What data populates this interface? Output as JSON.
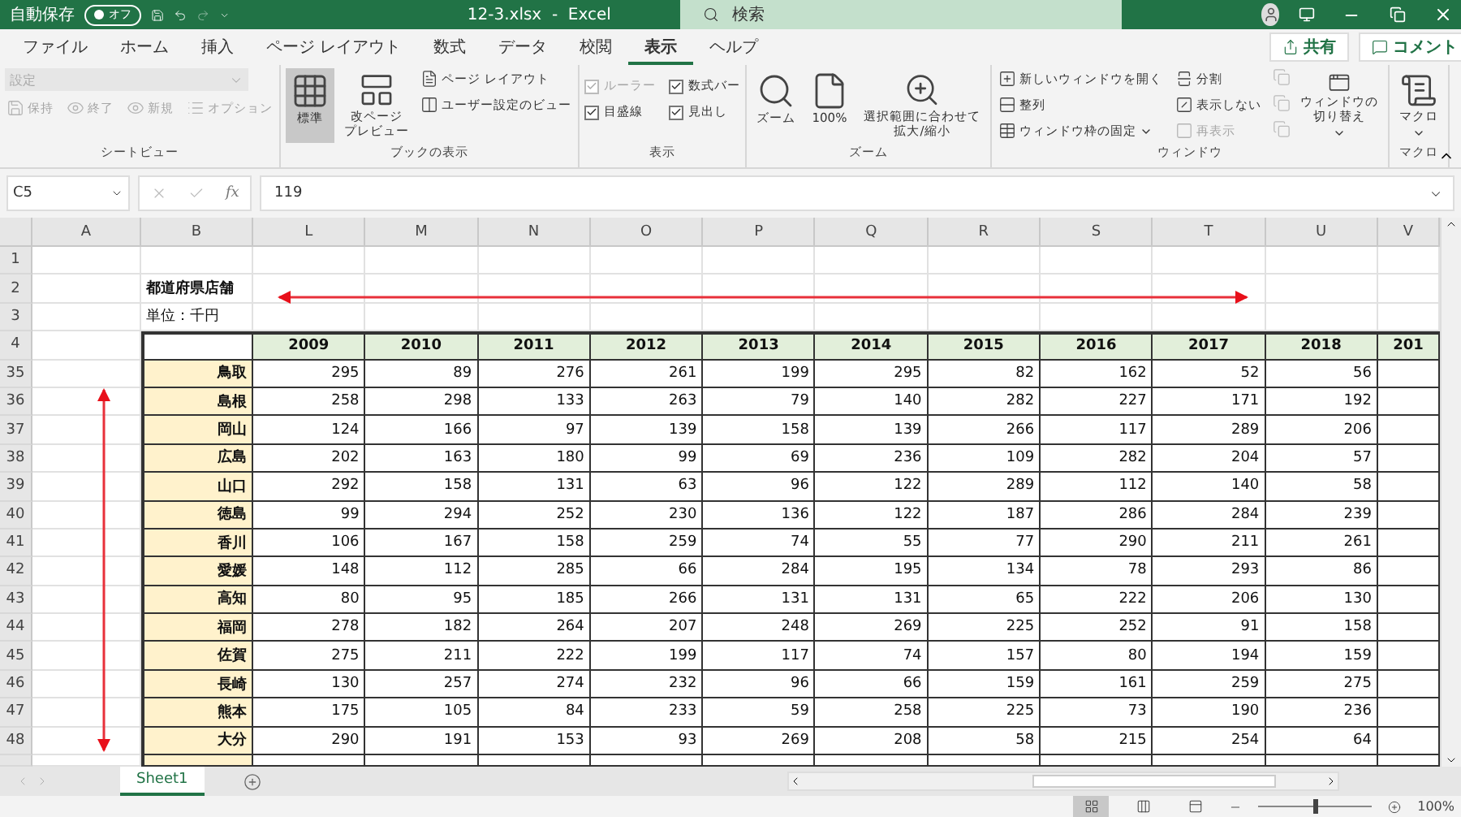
{
  "title_bar": {
    "autosave_label": "自動保存",
    "autosave_state": "オフ",
    "autosave_on": false,
    "file_title": "12-3.xlsx  -  Excel",
    "search_placeholder": "検索"
  },
  "menu_tabs": [
    {
      "label": "ファイル",
      "selected": false
    },
    {
      "label": "ホーム",
      "selected": false
    },
    {
      "label": "挿入",
      "selected": false
    },
    {
      "label": "ページ レイアウト",
      "selected": false
    },
    {
      "label": "数式",
      "selected": false
    },
    {
      "label": "データ",
      "selected": false
    },
    {
      "label": "校閲",
      "selected": false
    },
    {
      "label": "表示",
      "selected": true
    },
    {
      "label": "ヘルプ",
      "selected": false
    }
  ],
  "share_button": "共有",
  "comment_button": "コメント",
  "ribbon_groups": [
    {
      "label": "シートビュー",
      "items": [
        {
          "kind": "dropdown",
          "label": "設定",
          "disabled": true
        },
        {
          "kind": "small",
          "label": "保持",
          "disabled": true
        },
        {
          "kind": "small",
          "label": "終了",
          "disabled": true
        },
        {
          "kind": "small",
          "label": "新規",
          "disabled": true
        },
        {
          "kind": "small",
          "label": "オプション",
          "disabled": true
        }
      ]
    },
    {
      "label": "ブックの表示",
      "items": [
        {
          "kind": "large",
          "label": "標準",
          "selected": true
        },
        {
          "kind": "large",
          "lines": [
            "改ページ",
            "プレビュー"
          ],
          "selected": false
        },
        {
          "kind": "small",
          "label": "ページ レイアウト",
          "disabled": false
        },
        {
          "kind": "small",
          "label": "ユーザー設定のビュー",
          "disabled": false
        }
      ]
    },
    {
      "label": "表示",
      "items": [
        {
          "kind": "check",
          "label": "ルーラー",
          "checked": true,
          "disabled": true
        },
        {
          "kind": "check",
          "label": "目盛線",
          "checked": true,
          "disabled": false
        },
        {
          "kind": "check",
          "label": "数式バー",
          "checked": true,
          "disabled": false
        },
        {
          "kind": "check",
          "label": "見出し",
          "checked": true,
          "disabled": false
        }
      ]
    },
    {
      "label": "ズーム",
      "items": [
        {
          "kind": "large",
          "label": "ズーム",
          "selected": false
        },
        {
          "kind": "large",
          "label": "100%",
          "selected": false
        },
        {
          "kind": "large",
          "lines": [
            "選択範囲に合わせて",
            "拡大/縮小"
          ],
          "selected": false
        }
      ]
    },
    {
      "label": "ウィンドウ",
      "items": [
        {
          "kind": "small",
          "label": "新しいウィンドウを開く",
          "disabled": false
        },
        {
          "kind": "small",
          "label": "整列",
          "disabled": false
        },
        {
          "kind": "small",
          "label": "ウィンドウ枠の固定",
          "disabled": false,
          "dropdown": true
        },
        {
          "kind": "small",
          "label": "分割",
          "disabled": false
        },
        {
          "kind": "small",
          "label": "表示しない",
          "disabled": false
        },
        {
          "kind": "small",
          "label": "再表示",
          "disabled": true
        },
        {
          "kind": "icon",
          "disabled": true
        },
        {
          "kind": "icon",
          "disabled": true
        },
        {
          "kind": "icon",
          "disabled": true
        },
        {
          "kind": "large",
          "lines": [
            "ウィンドウの",
            "切り替え"
          ],
          "selected": false,
          "dropdown": true
        }
      ]
    },
    {
      "label": "マクロ",
      "items": [
        {
          "kind": "large",
          "label": "マクロ",
          "selected": false,
          "dropdown": true
        }
      ]
    }
  ],
  "formula_bar": {
    "name_box": "C5",
    "function_label": "fx",
    "formula": "119"
  },
  "sheet": {
    "columns": [
      "A",
      "B",
      "L",
      "M",
      "N",
      "O",
      "P",
      "Q",
      "R",
      "S",
      "T",
      "U",
      "V"
    ],
    "rows": [
      {
        "number": "1",
        "kind": "blank"
      },
      {
        "number": "2",
        "kind": "title",
        "text": "都道府県店舗"
      },
      {
        "number": "3",
        "kind": "unit",
        "text": "単位：千円"
      },
      {
        "number": "4",
        "kind": "header",
        "values": [
          "2009",
          "2010",
          "2011",
          "2012",
          "2013",
          "2014",
          "2015",
          "2016",
          "2017",
          "2018",
          "201"
        ]
      },
      {
        "number": "35",
        "kind": "data",
        "prefecture": "鳥取",
        "values": [
          "295",
          "89",
          "276",
          "261",
          "199",
          "295",
          "82",
          "162",
          "52",
          "56"
        ]
      },
      {
        "number": "36",
        "kind": "data",
        "prefecture": "島根",
        "values": [
          "258",
          "298",
          "133",
          "263",
          "79",
          "140",
          "282",
          "227",
          "171",
          "192"
        ]
      },
      {
        "number": "37",
        "kind": "data",
        "prefecture": "岡山",
        "values": [
          "124",
          "166",
          "97",
          "139",
          "158",
          "139",
          "266",
          "117",
          "289",
          "206"
        ]
      },
      {
        "number": "38",
        "kind": "data",
        "prefecture": "広島",
        "values": [
          "202",
          "163",
          "180",
          "99",
          "69",
          "236",
          "109",
          "282",
          "204",
          "57"
        ]
      },
      {
        "number": "39",
        "kind": "data",
        "prefecture": "山口",
        "values": [
          "292",
          "158",
          "131",
          "63",
          "96",
          "122",
          "289",
          "112",
          "140",
          "58"
        ]
      },
      {
        "number": "40",
        "kind": "data",
        "prefecture": "徳島",
        "values": [
          "99",
          "294",
          "252",
          "230",
          "136",
          "122",
          "187",
          "286",
          "284",
          "239"
        ]
      },
      {
        "number": "41",
        "kind": "data",
        "prefecture": "香川",
        "values": [
          "106",
          "167",
          "158",
          "259",
          "74",
          "55",
          "77",
          "290",
          "211",
          "261"
        ]
      },
      {
        "number": "42",
        "kind": "data",
        "prefecture": "愛媛",
        "values": [
          "148",
          "112",
          "285",
          "66",
          "284",
          "195",
          "134",
          "78",
          "293",
          "86"
        ]
      },
      {
        "number": "43",
        "kind": "data",
        "prefecture": "高知",
        "values": [
          "80",
          "95",
          "185",
          "266",
          "131",
          "131",
          "65",
          "222",
          "206",
          "130"
        ]
      },
      {
        "number": "44",
        "kind": "data",
        "prefecture": "福岡",
        "values": [
          "278",
          "182",
          "264",
          "207",
          "248",
          "269",
          "225",
          "252",
          "91",
          "158"
        ]
      },
      {
        "number": "45",
        "kind": "data",
        "prefecture": "佐賀",
        "values": [
          "275",
          "211",
          "222",
          "199",
          "117",
          "74",
          "157",
          "80",
          "194",
          "159"
        ]
      },
      {
        "number": "46",
        "kind": "data",
        "prefecture": "長崎",
        "values": [
          "130",
          "257",
          "274",
          "232",
          "96",
          "66",
          "159",
          "161",
          "259",
          "275"
        ]
      },
      {
        "number": "47",
        "kind": "data",
        "prefecture": "熊本",
        "values": [
          "175",
          "105",
          "84",
          "233",
          "59",
          "258",
          "225",
          "73",
          "190",
          "236"
        ]
      },
      {
        "number": "48",
        "kind": "data",
        "prefecture": "大分",
        "values": [
          "290",
          "191",
          "153",
          "93",
          "269",
          "208",
          "58",
          "215",
          "254",
          "64"
        ]
      }
    ]
  },
  "sheet_tabs": [
    {
      "label": "Sheet1",
      "selected": true
    }
  ],
  "status_bar": {
    "views": [
      {
        "selected": true
      },
      {
        "selected": false
      },
      {
        "selected": false
      }
    ],
    "zoom_slider": {
      "level": 0.5
    },
    "zoom_label": "100%"
  }
}
